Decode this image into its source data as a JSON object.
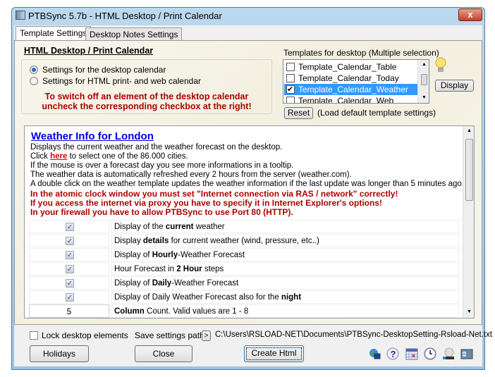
{
  "window": {
    "title": "PTBSync 5.7b - HTML Desktop / Print Calendar",
    "close": "x"
  },
  "tabs": [
    {
      "label": "Template Settings",
      "active": true
    },
    {
      "label": "Desktop Notes Settings",
      "active": false
    }
  ],
  "section_title": "HTML Desktop / Print Calendar",
  "radios": [
    {
      "label": "Settings for the desktop calendar",
      "selected": true
    },
    {
      "label": "Settings for HTML print- and web calendar",
      "selected": false
    }
  ],
  "notice": [
    "To switch off an element of the desktop calendar",
    "uncheck the corresponding checkbox at the right!"
  ],
  "templates": {
    "label": "Templates for desktop  (Multiple selection)",
    "items": [
      {
        "label": "Template_Calendar_Table",
        "checked": false,
        "selected": false
      },
      {
        "label": "Template_Calendar_Today",
        "checked": false,
        "selected": false
      },
      {
        "label": "Template_Calendar_Weather",
        "checked": true,
        "selected": true
      },
      {
        "label": "Template_Calendar_Web",
        "checked": false,
        "selected": false
      }
    ],
    "display_button": "Display",
    "reset_button": "Reset",
    "reset_hint": "(Load default template settings)"
  },
  "weather": {
    "title": "Weather Info for London",
    "line1": "Displays the current weather and the weather forecast on the desktop.",
    "click_pre": "Click ",
    "click_link": "here",
    "click_post": " to select one of the 86.000 cities.",
    "lines": [
      "If the mouse is over a forecast day you see more informations in a tooltip.",
      "The weather data is automatically refreshed every 2 hours from the server (weather.com).",
      "A double click on the weather template updates the weather information if the last update was longer than 5 minutes ago."
    ],
    "red_lines": [
      "In the atomic clock window you must set \"Internet connection via RAS / network\" correctly!",
      "If you access the internet via proxy you have to specify it in Internet Explorer's options!",
      "In your firewall you have to allow PTBSync to use Port 80 (HTTP)."
    ],
    "options": [
      {
        "checked": true,
        "pre": "Display of the ",
        "bold": "current",
        "post": " weather"
      },
      {
        "checked": true,
        "pre": "Display ",
        "bold": "details",
        "post": " for current weather (wind, pressure, etc..)"
      },
      {
        "checked": true,
        "pre": "Display of ",
        "bold": "Hourly",
        "post": "-Weather Forecast"
      },
      {
        "checked": true,
        "pre": "Hour Forecast in ",
        "bold": "2 Hour",
        "post": " steps"
      },
      {
        "checked": true,
        "pre": "Display of ",
        "bold": "Daily",
        "post": "-Weather Forecast"
      },
      {
        "checked": true,
        "pre": "Display of Daily Weather Forecast also for the ",
        "bold": "night",
        "post": ""
      }
    ],
    "column_count": {
      "value": "5",
      "pre": "",
      "bold": "Column",
      "post": " Count. Valid values are 1 - 8"
    }
  },
  "bottom": {
    "lock_label": "Lock desktop elements",
    "lock_checked": false,
    "save_path_label": "Save settings path",
    "save_path_button": ">",
    "save_path": "C:\\Users\\RSLOAD-NET\\Documents\\PTBSync-DesktopSetting-Rsload-Net.txt",
    "holidays": "Holidays",
    "close": "Close",
    "create_html": "Create Html",
    "icons": [
      "internet-icon",
      "help-icon",
      "calendar-icon",
      "clock-icon",
      "atomic-clock-icon",
      "desktop-icon"
    ]
  }
}
